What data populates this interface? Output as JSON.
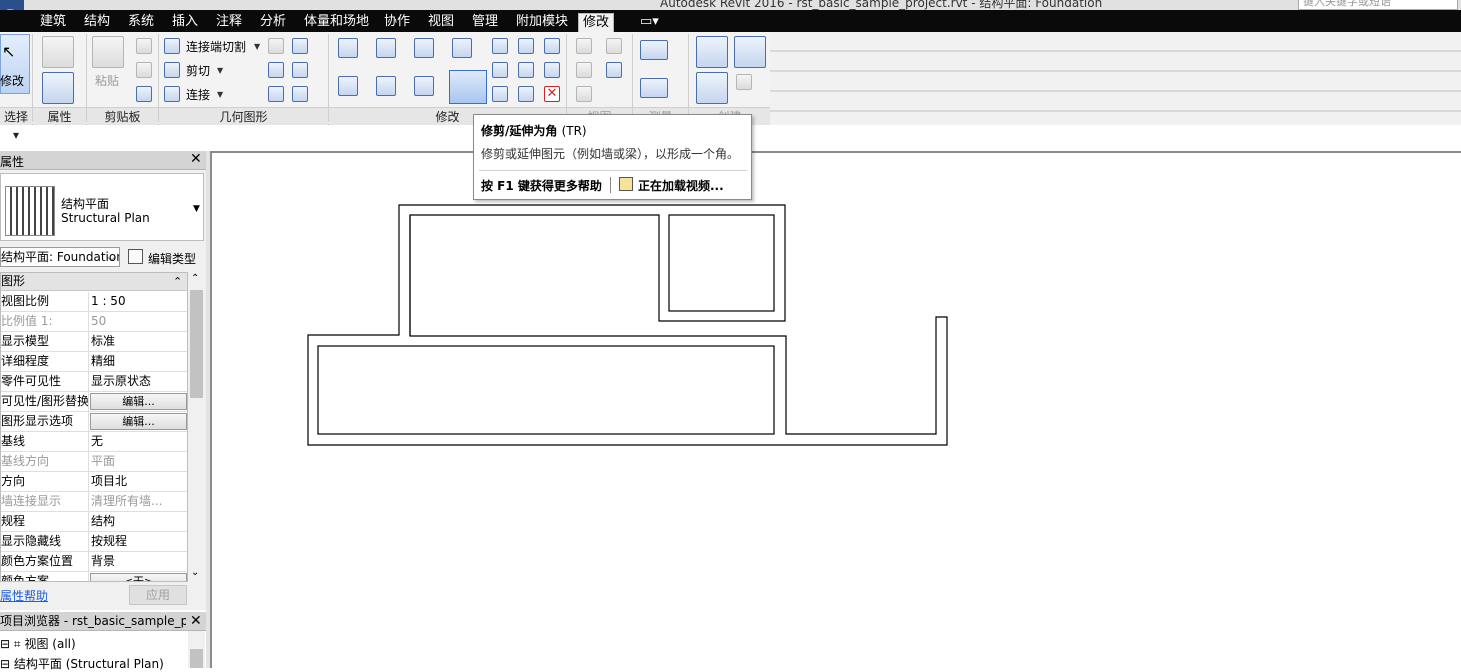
{
  "window": {
    "title": "Autodesk Revit 2016  -  rst_basic_sample_project.rvt - 结构平面: Foundation",
    "search_placeholder": "键入关键字或短语"
  },
  "ribbon": {
    "tabs": [
      "建筑",
      "结构",
      "系统",
      "插入",
      "注释",
      "分析",
      "体量和场地",
      "协作",
      "视图",
      "管理",
      "附加模块",
      "修改"
    ],
    "active_tab": "修改",
    "panels": {
      "select": "选择",
      "properties": "属性",
      "clipboard": "剪贴板",
      "geometry": "几何图形",
      "modify": "修改",
      "view": "视图",
      "measure": "测量",
      "create": "创建"
    },
    "modify_label": "修改",
    "paste_label": "粘贴",
    "geometry_items": {
      "cope": "连接端切割",
      "cut": "剪切",
      "join": "连接"
    }
  },
  "tooltip": {
    "title": "修剪/延伸为角",
    "shortcut": "(TR)",
    "description": "修剪或延伸图元（例如墙或梁），以形成一个角。",
    "help": "按 F1 键获得更多帮助",
    "video": "正在加载视频..."
  },
  "properties": {
    "panel_title": "属性",
    "type_name": "结构平面",
    "type_subname": "Structural Plan",
    "view_selector": "结构平面: Foundation",
    "edit_type": "编辑类型",
    "group": "图形",
    "rows": [
      {
        "name": "视图比例",
        "value": "1 : 50",
        "dim": false,
        "button": false
      },
      {
        "name": "比例值 1:",
        "value": "50",
        "dim": true,
        "button": false
      },
      {
        "name": "显示模型",
        "value": "标准",
        "dim": false,
        "button": false
      },
      {
        "name": "详细程度",
        "value": "精细",
        "dim": false,
        "button": false
      },
      {
        "name": "零件可见性",
        "value": "显示原状态",
        "dim": false,
        "button": false
      },
      {
        "name": "可见性/图形替换",
        "value": "编辑...",
        "dim": false,
        "button": true
      },
      {
        "name": "图形显示选项",
        "value": "编辑...",
        "dim": false,
        "button": true
      },
      {
        "name": "基线",
        "value": "无",
        "dim": false,
        "button": false
      },
      {
        "name": "基线方向",
        "value": "平面",
        "dim": true,
        "button": false
      },
      {
        "name": "方向",
        "value": "项目北",
        "dim": false,
        "button": false
      },
      {
        "name": "墙连接显示",
        "value": "清理所有墙...",
        "dim": true,
        "button": false
      },
      {
        "name": "规程",
        "value": "结构",
        "dim": false,
        "button": false
      },
      {
        "name": "显示隐藏线",
        "value": "按规程",
        "dim": false,
        "button": false
      },
      {
        "name": "颜色方案位置",
        "value": "背景",
        "dim": false,
        "button": false
      },
      {
        "name": "颜色方案",
        "value": "<无>",
        "dim": false,
        "button": true
      }
    ],
    "help_link": "属性帮助",
    "apply": "应用"
  },
  "browser": {
    "title": "项目浏览器 - rst_basic_sample_proj...",
    "tree_root": "视图 (all)",
    "tree_child": "结构平面 (Structural Plan)"
  },
  "colors": {
    "tab_bar": "#0a0a0a",
    "ribbon_bg": "#f3f3f3",
    "accent": "#3c6fc2"
  }
}
